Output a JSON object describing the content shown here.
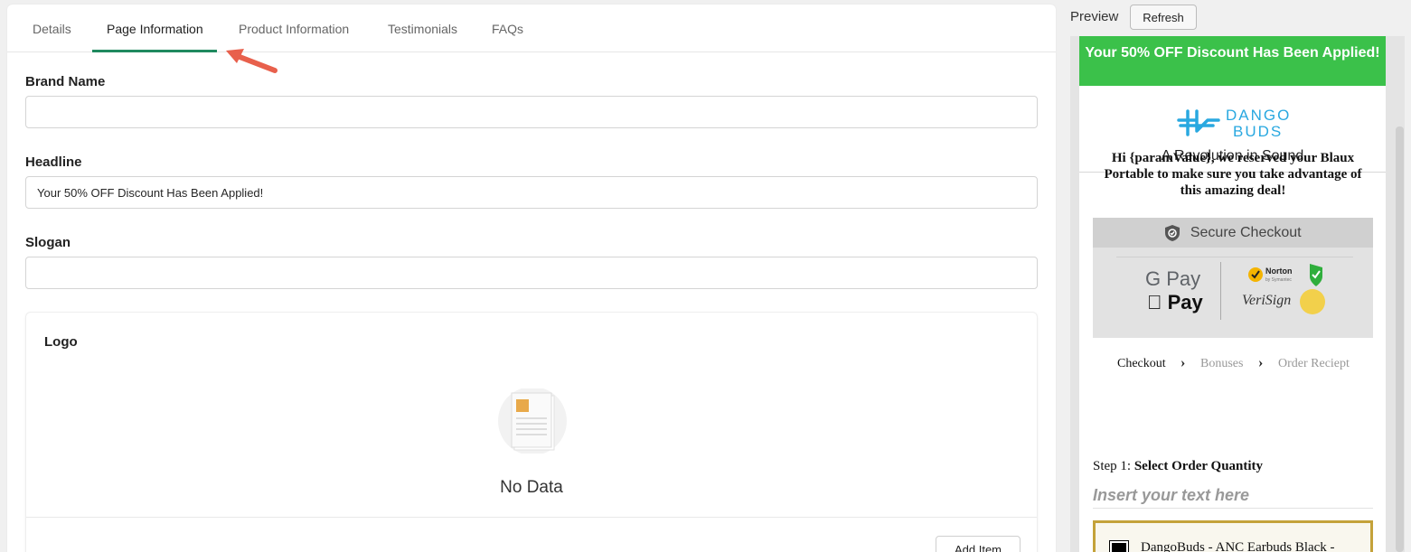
{
  "tabs": [
    {
      "label": "Details"
    },
    {
      "label": "Page Information"
    },
    {
      "label": "Product Information"
    },
    {
      "label": "Testimonials"
    },
    {
      "label": "FAQs"
    }
  ],
  "active_tab": "Page Information",
  "form": {
    "brand_name": {
      "label": "Brand Name",
      "value": ""
    },
    "headline": {
      "label": "Headline",
      "value": "Your 50% OFF Discount Has Been Applied!"
    },
    "slogan": {
      "label": "Slogan",
      "value": ""
    }
  },
  "logo_card": {
    "title": "Logo",
    "empty_text": "No Data",
    "add_button": "Add Item"
  },
  "preview": {
    "label": "Preview",
    "refresh_button": "Refresh",
    "banner": "Your 50% OFF Discount Has Been Applied!",
    "logo_text_1": "DANGO",
    "logo_text_2": "BUDS",
    "slogan": "A Revolution in Sound",
    "greeting": "Hi {paramValue}, we reserved your Blaux Portable to make sure you take advantage of this amazing deal!",
    "secure_checkout": "Secure Checkout",
    "gpay": "G Pay",
    "apple_pay": " Pay",
    "norton": "Norton",
    "norton_sub": "by Symantec",
    "verisign": "VeriSign",
    "steps": [
      "Checkout",
      "Bonuses",
      "Order Reciept"
    ],
    "step1_prefix": "Step 1: ",
    "step1_title": "Select Order Quantity",
    "insert_text": "Insert your text here",
    "product_name": "DangoBuds - ANC Earbuds Black -"
  },
  "colors": {
    "accent": "#1f8a5f",
    "banner_green": "#3bc14a",
    "logo_blue": "#29a8e0",
    "arrow": "#e8604c"
  }
}
